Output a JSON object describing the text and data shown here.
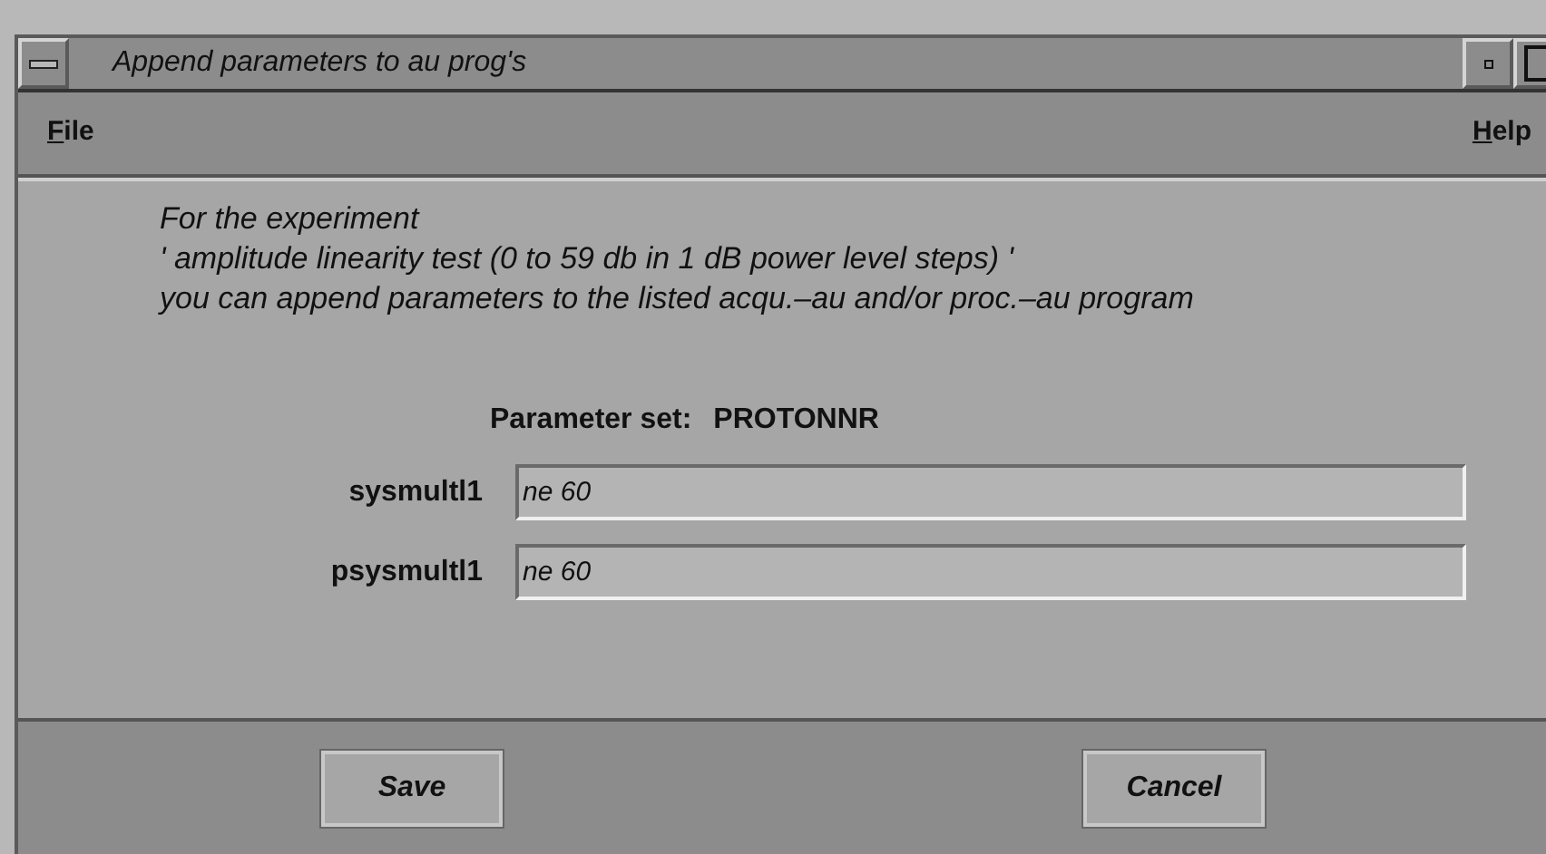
{
  "window": {
    "title": "Append parameters to au prog's"
  },
  "menu": [
    "File",
    "Help"
  ],
  "message": [
    "For the experiment",
    "' amplitude linearity test (0 to 59 db in 1 dB power level steps) '",
    "you can append parameters to the listed acqu.–au and/or proc.–au program"
  ],
  "parameter_set": {
    "label": "Parameter set:",
    "value": "PROTONNR"
  },
  "fields": [
    {
      "label": "sysmultl1",
      "value": "ne 60"
    },
    {
      "label": "psysmultl1",
      "value": "ne 60"
    }
  ],
  "buttons": [
    "Save",
    "Cancel"
  ]
}
